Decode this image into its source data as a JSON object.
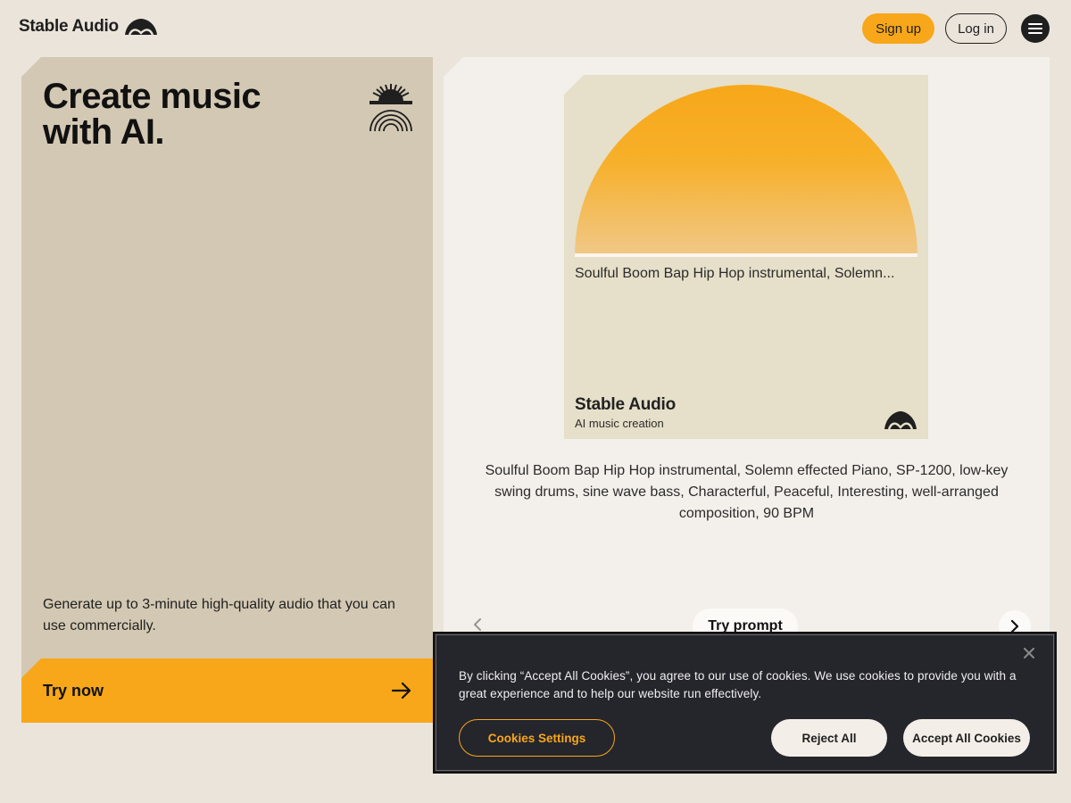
{
  "header": {
    "brand": "Stable Audio",
    "brand_icon": "stable-audio-logo",
    "signup_label": "Sign up",
    "login_label": "Log in",
    "menu_icon": "hamburger-menu-icon"
  },
  "hero": {
    "title": "Create music with AI.",
    "description": "Generate up to 3-minute high-quality audio that you can use commercially.",
    "cta_label": "Try now",
    "cta_icon": "arrow-right-icon"
  },
  "showcase": {
    "album_prompt": "Soulful Boom Bap Hip Hop instrumental, Solemn...",
    "album_brand": "Stable Audio",
    "album_sub": "AI music creation",
    "prompt_full": "Soulful Boom Bap Hip Hop instrumental, Solemn effected Piano, SP-1200, low-key swing drums, sine wave bass, Characterful, Peaceful, Interesting, well-arranged composition, 90 BPM",
    "try_prompt_label": "Try prompt"
  },
  "cookie_banner": {
    "text": "By clicking “Accept All Cookies”, you agree to our use of cookies. We use cookies to provide you with a great experience and to help our website run effectively.",
    "settings_label": "Cookies Settings",
    "reject_label": "Reject All",
    "accept_label": "Accept All Cookies"
  },
  "colors": {
    "accent": "#f7a719",
    "page_bg": "#ebe4da",
    "left_card_bg": "#d3c8b3",
    "right_card_bg": "#f3f0eb",
    "banner_bg": "#25252c"
  }
}
